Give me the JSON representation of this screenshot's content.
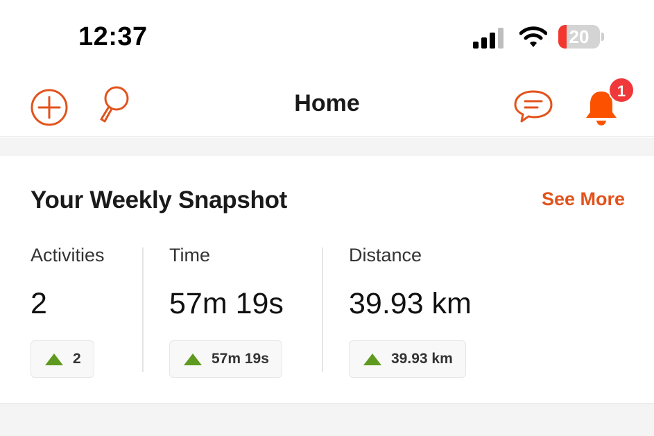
{
  "status_bar": {
    "time": "12:37",
    "battery_level": "20",
    "battery_fraction": 0.2,
    "battery_color": "#f2372e"
  },
  "nav": {
    "title": "Home",
    "left_icons": [
      "add-circle-icon",
      "search-icon"
    ],
    "right_icons": [
      "chat-icon",
      "bell-icon"
    ],
    "notification_count": "1",
    "accent_color": "#e2531c"
  },
  "snapshot": {
    "title": "Your Weekly Snapshot",
    "see_more": "See More",
    "stats": [
      {
        "label": "Activities",
        "value": "2",
        "change": "2",
        "trend": "up"
      },
      {
        "label": "Time",
        "value": "57m 19s",
        "change": "57m 19s",
        "trend": "up"
      },
      {
        "label": "Distance",
        "value": "39.93 km",
        "change": "39.93 km",
        "trend": "up"
      }
    ],
    "trend_color": "#5e9a1f"
  }
}
